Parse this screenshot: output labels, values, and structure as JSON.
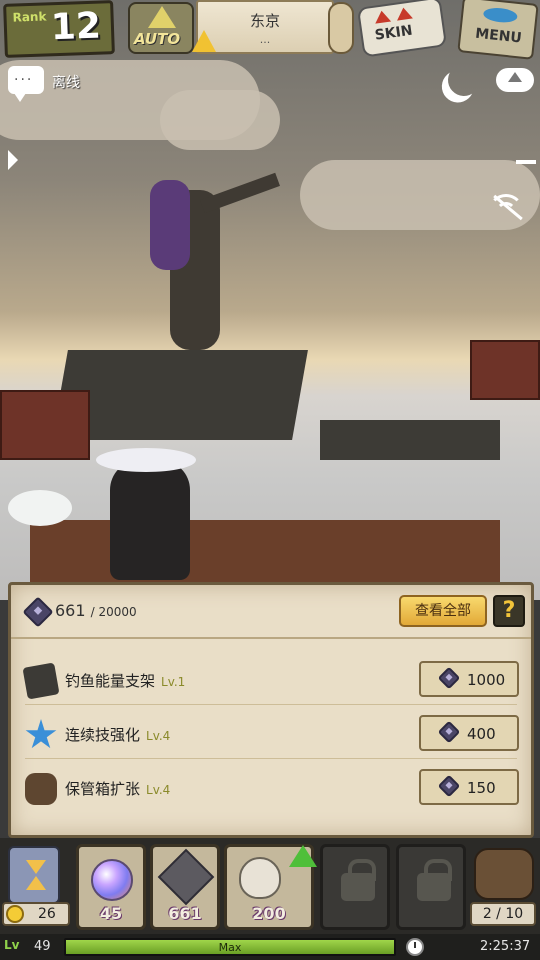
{
  "hud": {
    "rank_label": "Rank",
    "rank_value": "12",
    "auto_label": "AUTO",
    "location_name": "东京",
    "location_sub": "...",
    "skin_label": "SKIN",
    "menu_label": "MENU"
  },
  "status": {
    "offline_label": "离线"
  },
  "panel": {
    "gem_count": "661",
    "gem_max": "/ 20000",
    "view_all_label": "查看全部",
    "help_label": "?",
    "items": [
      {
        "name": "钓鱼能量支架",
        "level": "Lv.1",
        "cost": "1000",
        "icon": "energy-rack-icon"
      },
      {
        "name": "连续技强化",
        "level": "Lv.4",
        "cost": "400",
        "icon": "combo-star-icon"
      },
      {
        "name": "保管箱扩张",
        "level": "Lv.4",
        "cost": "150",
        "icon": "storage-bag-icon"
      }
    ]
  },
  "bottom": {
    "bait_count": "26",
    "slots": [
      {
        "count": "45",
        "icon": "orb-icon"
      },
      {
        "count": "661",
        "icon": "gem-icon"
      },
      {
        "count": "200",
        "icon": "shell-icon"
      }
    ],
    "bag_count": "2 / 10",
    "level_value": "49",
    "xp_label": "Max",
    "xp_fraction": 1.0,
    "time": "2:25:37"
  },
  "colors": {
    "accent_gold": "#e2a937",
    "xp_green": "#6a9f25",
    "panel_bg": "#e9dec7"
  }
}
